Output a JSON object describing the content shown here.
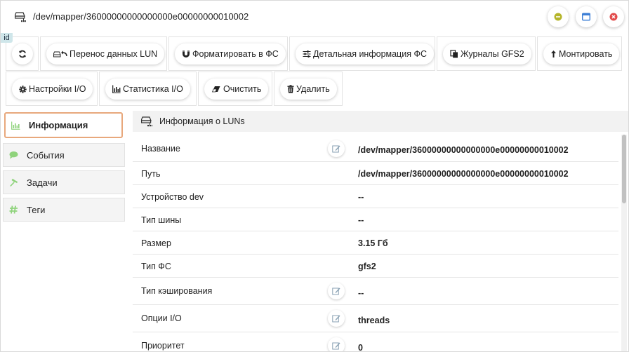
{
  "window": {
    "title": "/dev/mapper/36000000000000000e00000000010002",
    "icons": {
      "title": "storage-tree-icon",
      "minimize": "minimize-icon",
      "maximize": "maximize-icon",
      "close": "close-icon"
    },
    "colors": {
      "minimize": "#b5b52a",
      "maximize": "#3d7fd6",
      "close": "#e24b4b"
    }
  },
  "badge": {
    "label": "id"
  },
  "toolbar": {
    "refresh": {
      "icon": "refresh-icon"
    },
    "transfer": {
      "label": "Перенос данных LUN",
      "icon": "transfer-icon"
    },
    "format": {
      "label": "Форматировать в ФС",
      "icon": "magnet-icon"
    },
    "fs_details": {
      "label": "Детальная информация ФС",
      "icon": "sliders-icon"
    },
    "gfs2_logs": {
      "label": "Журналы GFS2",
      "icon": "copy-icon"
    },
    "mount": {
      "label": "Монтировать",
      "icon": "upload-icon"
    },
    "io_settings": {
      "label": "Настройки I/O",
      "icon": "gear-icon"
    },
    "io_stats": {
      "label": "Статистика I/O",
      "icon": "bar-chart-icon"
    },
    "clear": {
      "label": "Очистить",
      "icon": "eraser-icon"
    },
    "delete": {
      "label": "Удалить",
      "icon": "trash-icon"
    }
  },
  "sidebar": {
    "items": [
      {
        "label": "Информация",
        "icon": "bar-chart-icon",
        "active": true
      },
      {
        "label": "События",
        "icon": "comment-icon"
      },
      {
        "label": "Задачи",
        "icon": "hammer-icon"
      },
      {
        "label": "Теги",
        "icon": "hashtag-icon"
      }
    ]
  },
  "panel": {
    "title": "Информация о LUNs",
    "icon": "storage-tree-icon",
    "rows": [
      {
        "label": "Название",
        "value": "/dev/mapper/36000000000000000e00000000010002",
        "editable": true
      },
      {
        "label": "Путь",
        "value": "/dev/mapper/36000000000000000e00000000010002",
        "editable": false
      },
      {
        "label": "Устройство dev",
        "value": "--",
        "editable": false
      },
      {
        "label": "Тип шины",
        "value": "--",
        "editable": false
      },
      {
        "label": "Размер",
        "value": "3.15 Гб",
        "editable": false
      },
      {
        "label": "Тип ФС",
        "value": "gfs2",
        "editable": false
      },
      {
        "label": "Тип кэширования",
        "value": "--",
        "editable": true
      },
      {
        "label": "Опции I/O",
        "value": "threads",
        "editable": true
      },
      {
        "label": "Приоритет",
        "value": "0",
        "editable": true
      }
    ]
  }
}
